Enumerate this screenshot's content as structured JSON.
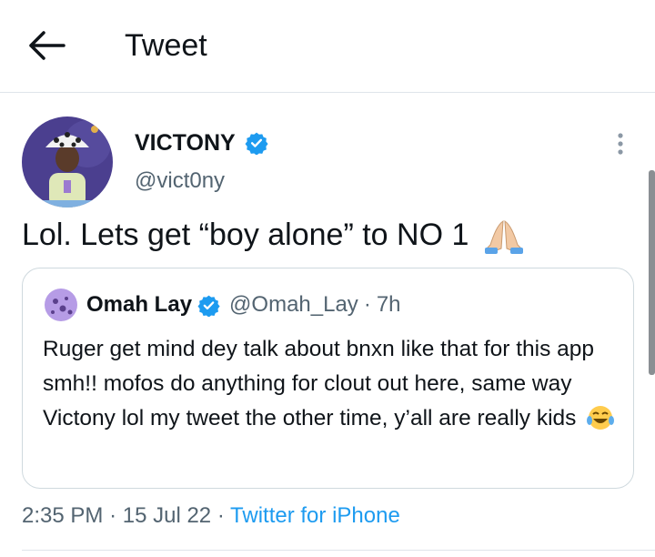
{
  "header": {
    "title": "Tweet",
    "back_icon": "arrow-left-icon"
  },
  "tweet": {
    "author_name": "VICTONY",
    "author_handle": "@vict0ny",
    "verified_icon": "verified-badge-icon",
    "text": "Lol. Lets get “boy alone” to NO 1",
    "emoji": "folded-hands-emoji",
    "more_icon": "more-vertical-icon"
  },
  "quote": {
    "author_name": "Omah Lay",
    "author_handle": "@Omah_Lay",
    "separator": "·",
    "time": "7h",
    "text": "Ruger get mind dey talk about bnxn like that for this app smh!! mofos do anything for clout out here, same way Victony lol my tweet the other time, y’all are really kids",
    "emoji": "tears-of-joy-emoji"
  },
  "meta": {
    "time": "2:35 PM",
    "sep1": "·",
    "date": "15 Jul 22",
    "sep2": "·",
    "source": "Twitter for iPhone"
  },
  "colors": {
    "accent": "#1d9bf0",
    "secondary_text": "#536471",
    "border": "#cfd9de"
  }
}
